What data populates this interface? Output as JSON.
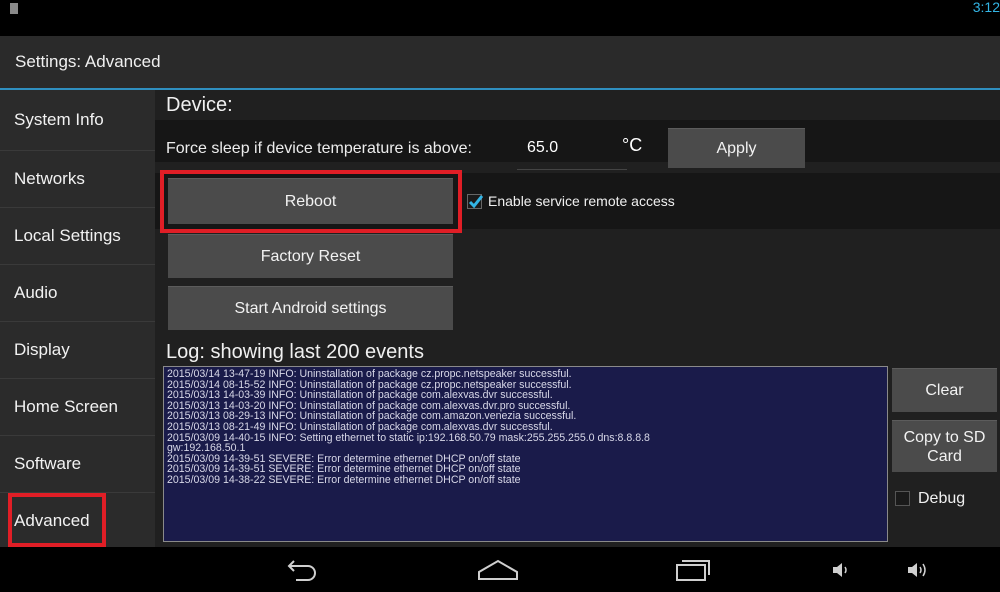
{
  "status_bar": {
    "time": "3:12",
    "sd_icon": "sd-card-icon"
  },
  "action_bar": {
    "title": "Settings: Advanced"
  },
  "sidebar": {
    "items": [
      {
        "label": "System Info"
      },
      {
        "label": "Networks"
      },
      {
        "label": "Local Settings"
      },
      {
        "label": "Audio"
      },
      {
        "label": "Display"
      },
      {
        "label": "Home Screen"
      },
      {
        "label": "Software"
      },
      {
        "label": "Advanced",
        "active": true
      }
    ]
  },
  "device": {
    "heading": "Device:",
    "temp_label": "Force sleep if device temperature is above:",
    "temp_value": "65.0",
    "temp_unit": "°C",
    "apply_label": "Apply",
    "reboot_label": "Reboot",
    "remote_access_label": "Enable service remote access",
    "remote_access_checked": true,
    "factory_reset_label": "Factory Reset",
    "android_settings_label": "Start Android settings"
  },
  "log": {
    "heading": "Log: showing last 200 events",
    "lines": [
      "2015/03/14 13-47-19 INFO: Uninstallation of package cz.propc.netspeaker successful.",
      "2015/03/14 08-15-52 INFO: Uninstallation of package cz.propc.netspeaker successful.",
      "2015/03/13 14-03-39 INFO: Uninstallation of package com.alexvas.dvr successful.",
      "2015/03/13 14-03-20 INFO: Uninstallation of package com.alexvas.dvr.pro successful.",
      "2015/03/13 08-29-13 INFO: Uninstallation of package com.amazon.venezia successful.",
      "2015/03/13 08-21-49 INFO: Uninstallation of package com.alexvas.dvr successful.",
      "2015/03/09 14-40-15 INFO: Setting ethernet to static ip:192.168.50.79 mask:255.255.255.0 dns:8.8.8.8",
      "gw:192.168.50.1",
      "2015/03/09 14-39-51 SEVERE: Error determine ethernet DHCP on/off state",
      "2015/03/09 14-39-51 SEVERE: Error determine ethernet DHCP on/off state",
      "2015/03/09 14-38-22 SEVERE: Error determine ethernet DHCP on/off state"
    ],
    "clear_label": "Clear",
    "copy_label_1": "Copy to SD",
    "copy_label_2": "Card",
    "debug_label": "Debug",
    "debug_checked": false
  },
  "nav_bar": {
    "icons": [
      "back-icon",
      "home-icon",
      "recents-icon",
      "volume-down-icon",
      "volume-up-icon"
    ]
  },
  "colors": {
    "accent": "#33b5e5",
    "highlight": "#e01e26",
    "log_bg": "#1a1b4a"
  }
}
